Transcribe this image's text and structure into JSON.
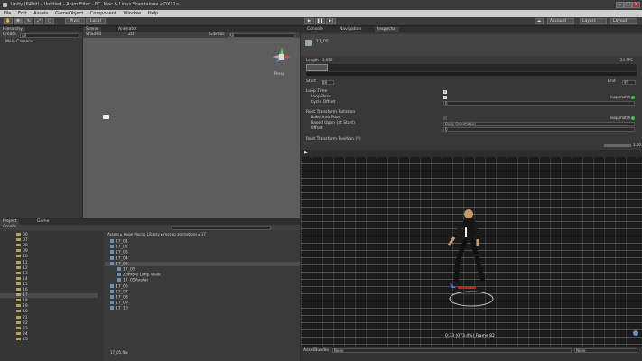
{
  "window": {
    "title": "Unity (64bit) - Untitled - Anim Filter - PC, Mac & Linux Standalone <DX11>"
  },
  "menu": [
    "File",
    "Edit",
    "Assets",
    "GameObject",
    "Component",
    "Window",
    "Help"
  ],
  "toolbar": {
    "pivot": "Pivot",
    "local": "Local",
    "account": "Account",
    "layers": "Layers",
    "layout": "Layout"
  },
  "hierarchy": {
    "tab": "Hierarchy",
    "create": "Create",
    "search": "All",
    "items": [
      "Main Camera"
    ]
  },
  "scene": {
    "tab": "Scene",
    "tab2": "Animator",
    "shading": "Shaded",
    "mode": "2D",
    "gizmos": "Gizmos",
    "search": "All",
    "persp": "Persp"
  },
  "inspector": {
    "tabs": [
      "Console",
      "Navigation",
      "Inspector"
    ],
    "clip_name": "17_05",
    "length_label": "Length",
    "length_value": "3.050",
    "fps": "24 FPS",
    "start_label": "Start",
    "start_value": "88",
    "end_label": "End",
    "end_value": "95",
    "loop_time": "Loop Time",
    "loop_pose": "Loop Pose",
    "cycle_offset": "Cycle Offset",
    "cycle_value": "0",
    "loop_match": "loop match",
    "root_rot": "Root Transform Rotation",
    "bake": "Bake Into Pose",
    "based": "Based Upon (at Start)",
    "based_value": "Body Orientation",
    "offset": "Offset",
    "offset_value": "0",
    "root_pos": "Root Transform Position (Y)",
    "speed": "1.00"
  },
  "project": {
    "tab": "Project",
    "tab2": "Game",
    "create": "Create",
    "breadcrumb": "Assets ▸ Huge Mocap Library ▸ mocap animations ▸ 17",
    "folders": [
      "06",
      "07",
      "08",
      "09",
      "10",
      "11",
      "12",
      "13",
      "14",
      "15",
      "16",
      "17",
      "18",
      "19",
      "20",
      "21",
      "22",
      "23",
      "24",
      "25"
    ],
    "files": [
      "17_01",
      "17_02",
      "17_03",
      "17_04",
      "17_05",
      "17_05",
      "Zombie Limp Walk",
      "17_05Avatar",
      "17_06",
      "17_07",
      "17_08",
      "17_09",
      "17_10"
    ],
    "status": "17_05.fbx"
  },
  "game": {
    "status": "0:33 (073.4%) Frame 82"
  },
  "assetbundle": {
    "label": "AssetBundle",
    "value1": "None",
    "value2": "None"
  }
}
